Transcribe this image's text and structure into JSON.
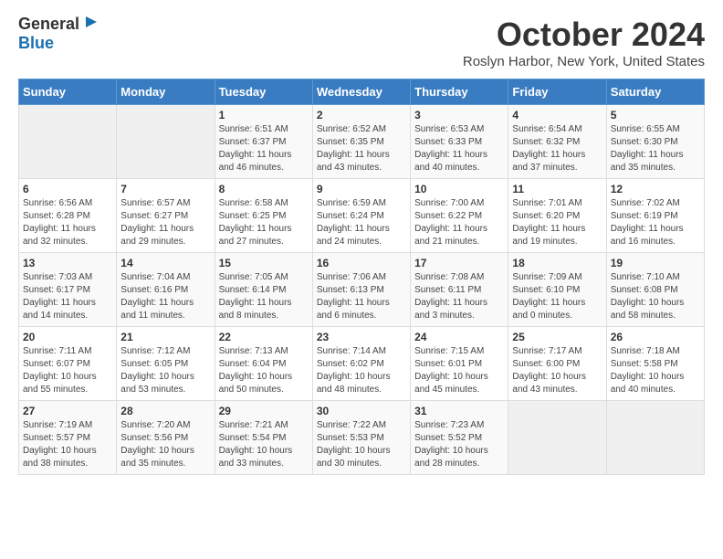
{
  "logo": {
    "line1": "General",
    "line2": "Blue"
  },
  "title": "October 2024",
  "subtitle": "Roslyn Harbor, New York, United States",
  "days_of_week": [
    "Sunday",
    "Monday",
    "Tuesday",
    "Wednesday",
    "Thursday",
    "Friday",
    "Saturday"
  ],
  "weeks": [
    [
      {
        "day": "",
        "info": ""
      },
      {
        "day": "",
        "info": ""
      },
      {
        "day": "1",
        "info": "Sunrise: 6:51 AM\nSunset: 6:37 PM\nDaylight: 11 hours and 46 minutes."
      },
      {
        "day": "2",
        "info": "Sunrise: 6:52 AM\nSunset: 6:35 PM\nDaylight: 11 hours and 43 minutes."
      },
      {
        "day": "3",
        "info": "Sunrise: 6:53 AM\nSunset: 6:33 PM\nDaylight: 11 hours and 40 minutes."
      },
      {
        "day": "4",
        "info": "Sunrise: 6:54 AM\nSunset: 6:32 PM\nDaylight: 11 hours and 37 minutes."
      },
      {
        "day": "5",
        "info": "Sunrise: 6:55 AM\nSunset: 6:30 PM\nDaylight: 11 hours and 35 minutes."
      }
    ],
    [
      {
        "day": "6",
        "info": "Sunrise: 6:56 AM\nSunset: 6:28 PM\nDaylight: 11 hours and 32 minutes."
      },
      {
        "day": "7",
        "info": "Sunrise: 6:57 AM\nSunset: 6:27 PM\nDaylight: 11 hours and 29 minutes."
      },
      {
        "day": "8",
        "info": "Sunrise: 6:58 AM\nSunset: 6:25 PM\nDaylight: 11 hours and 27 minutes."
      },
      {
        "day": "9",
        "info": "Sunrise: 6:59 AM\nSunset: 6:24 PM\nDaylight: 11 hours and 24 minutes."
      },
      {
        "day": "10",
        "info": "Sunrise: 7:00 AM\nSunset: 6:22 PM\nDaylight: 11 hours and 21 minutes."
      },
      {
        "day": "11",
        "info": "Sunrise: 7:01 AM\nSunset: 6:20 PM\nDaylight: 11 hours and 19 minutes."
      },
      {
        "day": "12",
        "info": "Sunrise: 7:02 AM\nSunset: 6:19 PM\nDaylight: 11 hours and 16 minutes."
      }
    ],
    [
      {
        "day": "13",
        "info": "Sunrise: 7:03 AM\nSunset: 6:17 PM\nDaylight: 11 hours and 14 minutes."
      },
      {
        "day": "14",
        "info": "Sunrise: 7:04 AM\nSunset: 6:16 PM\nDaylight: 11 hours and 11 minutes."
      },
      {
        "day": "15",
        "info": "Sunrise: 7:05 AM\nSunset: 6:14 PM\nDaylight: 11 hours and 8 minutes."
      },
      {
        "day": "16",
        "info": "Sunrise: 7:06 AM\nSunset: 6:13 PM\nDaylight: 11 hours and 6 minutes."
      },
      {
        "day": "17",
        "info": "Sunrise: 7:08 AM\nSunset: 6:11 PM\nDaylight: 11 hours and 3 minutes."
      },
      {
        "day": "18",
        "info": "Sunrise: 7:09 AM\nSunset: 6:10 PM\nDaylight: 11 hours and 0 minutes."
      },
      {
        "day": "19",
        "info": "Sunrise: 7:10 AM\nSunset: 6:08 PM\nDaylight: 10 hours and 58 minutes."
      }
    ],
    [
      {
        "day": "20",
        "info": "Sunrise: 7:11 AM\nSunset: 6:07 PM\nDaylight: 10 hours and 55 minutes."
      },
      {
        "day": "21",
        "info": "Sunrise: 7:12 AM\nSunset: 6:05 PM\nDaylight: 10 hours and 53 minutes."
      },
      {
        "day": "22",
        "info": "Sunrise: 7:13 AM\nSunset: 6:04 PM\nDaylight: 10 hours and 50 minutes."
      },
      {
        "day": "23",
        "info": "Sunrise: 7:14 AM\nSunset: 6:02 PM\nDaylight: 10 hours and 48 minutes."
      },
      {
        "day": "24",
        "info": "Sunrise: 7:15 AM\nSunset: 6:01 PM\nDaylight: 10 hours and 45 minutes."
      },
      {
        "day": "25",
        "info": "Sunrise: 7:17 AM\nSunset: 6:00 PM\nDaylight: 10 hours and 43 minutes."
      },
      {
        "day": "26",
        "info": "Sunrise: 7:18 AM\nSunset: 5:58 PM\nDaylight: 10 hours and 40 minutes."
      }
    ],
    [
      {
        "day": "27",
        "info": "Sunrise: 7:19 AM\nSunset: 5:57 PM\nDaylight: 10 hours and 38 minutes."
      },
      {
        "day": "28",
        "info": "Sunrise: 7:20 AM\nSunset: 5:56 PM\nDaylight: 10 hours and 35 minutes."
      },
      {
        "day": "29",
        "info": "Sunrise: 7:21 AM\nSunset: 5:54 PM\nDaylight: 10 hours and 33 minutes."
      },
      {
        "day": "30",
        "info": "Sunrise: 7:22 AM\nSunset: 5:53 PM\nDaylight: 10 hours and 30 minutes."
      },
      {
        "day": "31",
        "info": "Sunrise: 7:23 AM\nSunset: 5:52 PM\nDaylight: 10 hours and 28 minutes."
      },
      {
        "day": "",
        "info": ""
      },
      {
        "day": "",
        "info": ""
      }
    ]
  ]
}
